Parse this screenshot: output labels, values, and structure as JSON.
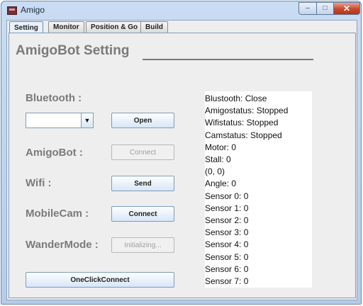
{
  "window": {
    "title": "Amigo",
    "minimize": "–",
    "maximize": "□",
    "close": "✕"
  },
  "tabs": [
    {
      "label": "Setting",
      "active": true
    },
    {
      "label": "Monitor",
      "active": false
    },
    {
      "label": "Position & Go",
      "active": false
    },
    {
      "label": "Build",
      "active": false
    }
  ],
  "heading": "AmigoBot Setting",
  "bluetooth": {
    "label": "Bluetooth :",
    "combo_value": "",
    "button": "Open"
  },
  "amigobot": {
    "label": "AmigoBot :",
    "button": "Connect",
    "enabled": false
  },
  "wifi": {
    "label": "Wifi :",
    "button": "Send",
    "enabled": true
  },
  "mobilecam": {
    "label": "MobileCam :",
    "button": "Connect",
    "enabled": true
  },
  "wandermode": {
    "label": "WanderMode :",
    "button": "Initializing...",
    "enabled": false
  },
  "oneclick": {
    "label": "OneClickConnect"
  },
  "status_lines": [
    "Blustooth: Close",
    "Amigostatus: Stopped",
    "Wifistatus: Stopped",
    "Camstatus: Stopped",
    "Motor: 0",
    "Stall: 0",
    "(0, 0)",
    "Angle: 0",
    "Sensor 0: 0",
    "Sensor 1: 0",
    "Sensor 2: 0",
    "Sensor 3: 0",
    "Sensor 4: 0",
    "Sensor 5: 0",
    "Sensor 6: 0",
    "Sensor 7: 0"
  ]
}
